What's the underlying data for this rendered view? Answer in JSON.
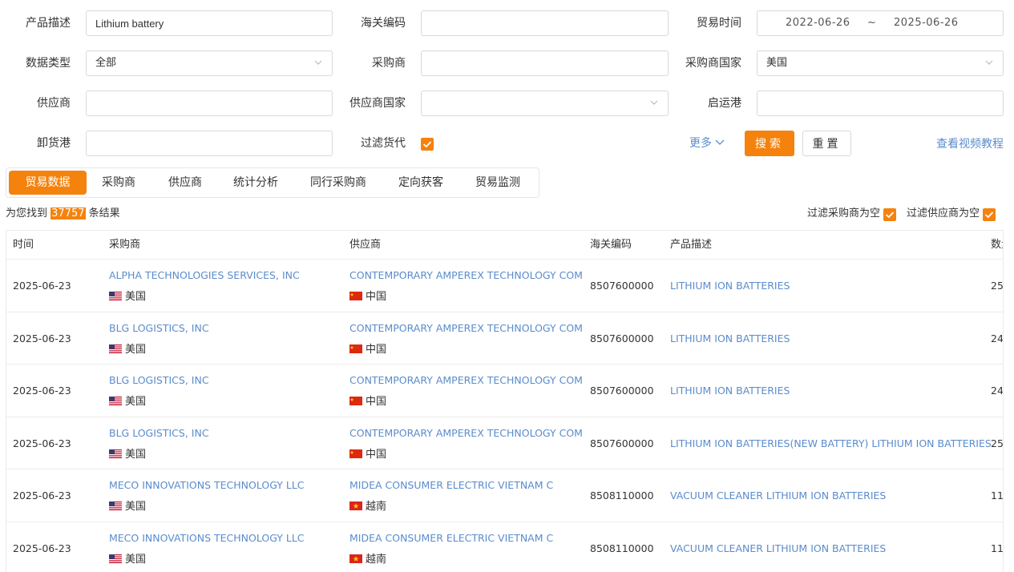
{
  "filters": {
    "product_desc_label": "产品描述",
    "product_desc_value": "Lithium battery",
    "hs_code_label": "海关编码",
    "hs_code_value": "",
    "trade_time_label": "贸易时间",
    "trade_time_start": "2022-06-26",
    "trade_time_sep": "~",
    "trade_time_end": "2025-06-26",
    "data_type_label": "数据类型",
    "data_type_value": "全部",
    "buyer_label": "采购商",
    "buyer_value": "",
    "buyer_country_label": "采购商国家",
    "buyer_country_value": "美国",
    "supplier_label": "供应商",
    "supplier_value": "",
    "supplier_country_label": "供应商国家",
    "supplier_country_value": "",
    "departure_port_label": "启运港",
    "departure_port_value": "",
    "arrival_port_label": "卸货港",
    "arrival_port_value": "",
    "filter_forwarder_label": "过滤货代",
    "filter_forwarder_checked": true,
    "more_label": "更多",
    "search_label": "搜索",
    "reset_label": "重置",
    "video_tutorial_label": "查看视频教程"
  },
  "tabs": [
    {
      "label": "贸易数据",
      "active": true
    },
    {
      "label": "采购商",
      "active": false
    },
    {
      "label": "供应商",
      "active": false
    },
    {
      "label": "统计分析",
      "active": false
    },
    {
      "label": "同行采购商",
      "active": false
    },
    {
      "label": "定向获客",
      "active": false
    },
    {
      "label": "贸易监测",
      "active": false
    }
  ],
  "results": {
    "prefix": "为您找到",
    "count": "37757",
    "suffix": "条结果",
    "filter_empty_buyer": "过滤采购商为空",
    "filter_empty_supplier": "过滤供应商为空"
  },
  "table": {
    "columns": [
      "时间",
      "采购商",
      "供应商",
      "海关编码",
      "产品描述",
      "数量"
    ],
    "rows": [
      {
        "date": "2025-06-23",
        "buyer": "ALPHA TECHNOLOGIES SERVICES, INC",
        "buyer_country": "美国",
        "supplier": "CONTEMPORARY AMPEREX TECHNOLOGY COM",
        "supplier_country": "中国",
        "hs_code": "8507600000",
        "product": "LITHIUM ION BATTERIES",
        "qty": "25"
      },
      {
        "date": "2025-06-23",
        "buyer": "BLG LOGISTICS, INC",
        "buyer_country": "美国",
        "supplier": "CONTEMPORARY AMPEREX TECHNOLOGY COM",
        "supplier_country": "中国",
        "hs_code": "8507600000",
        "product": "LITHIUM ION BATTERIES",
        "qty": "24"
      },
      {
        "date": "2025-06-23",
        "buyer": "BLG LOGISTICS, INC",
        "buyer_country": "美国",
        "supplier": "CONTEMPORARY AMPEREX TECHNOLOGY COM",
        "supplier_country": "中国",
        "hs_code": "8507600000",
        "product": "LITHIUM ION BATTERIES",
        "qty": "24"
      },
      {
        "date": "2025-06-23",
        "buyer": "BLG LOGISTICS, INC",
        "buyer_country": "美国",
        "supplier": "CONTEMPORARY AMPEREX TECHNOLOGY COM",
        "supplier_country": "中国",
        "hs_code": "8507600000",
        "product": "LITHIUM ION BATTERIES(NEW BATTERY) LITHIUM ION BATTERIES",
        "qty": "25"
      },
      {
        "date": "2025-06-23",
        "buyer": "MECO INNOVATIONS TECHNOLOGY LLC",
        "buyer_country": "美国",
        "supplier": "MIDEA CONSUMER ELECTRIC VIETNAM C",
        "supplier_country": "越南",
        "hs_code": "8508110000",
        "product": "VACUUM CLEANER LITHIUM ION BATTERIES",
        "qty": "11"
      },
      {
        "date": "2025-06-23",
        "buyer": "MECO INNOVATIONS TECHNOLOGY LLC",
        "buyer_country": "美国",
        "supplier": "MIDEA CONSUMER ELECTRIC VIETNAM C",
        "supplier_country": "越南",
        "hs_code": "8508110000",
        "product": "VACUUM CLEANER LITHIUM ION BATTERIES",
        "qty": "11"
      }
    ]
  },
  "colors": {
    "accent": "#f5820d",
    "link": "#5b8ccc"
  },
  "icons": {
    "chevron": "chevron-down-icon",
    "check": "check-icon",
    "flag_us": "flag-us-icon",
    "flag_cn": "flag-cn-icon",
    "flag_vn": "flag-vn-icon"
  }
}
